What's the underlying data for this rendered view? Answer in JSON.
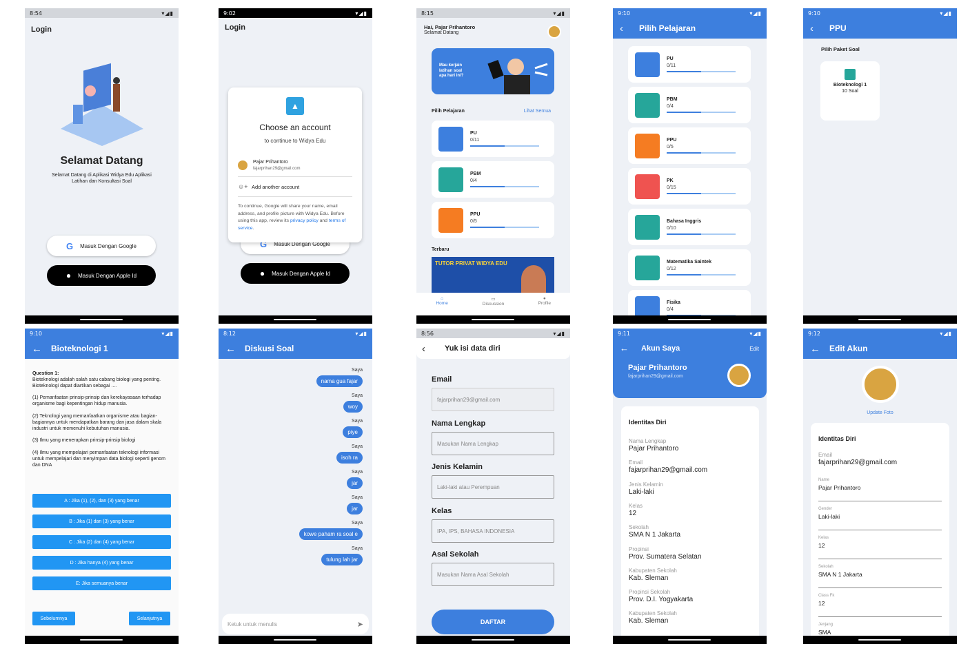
{
  "s1": {
    "time": "8:54",
    "title": "Login",
    "welcome": "Selamat Datang",
    "desc": "Selamat Datang di Aplikasi Widya Edu Aplikasi Latihan dan Konsultasi Soal",
    "google_btn": "Masuk Dengan Google",
    "apple_btn": "Masuk Dengan Apple Id"
  },
  "s2": {
    "time": "9:02",
    "title": "Login",
    "dialog_title": "Choose an account",
    "dialog_sub": "to continue to Widya Edu",
    "acct_name": "Pajar Prihantoro",
    "acct_email": "fajarprihan29@gmail.com",
    "add_account": "Add another account",
    "notice": "To continue, Google will share your name, email address, and profile picture with Widya Edu. Before using this app, review its",
    "privacy": "privacy policy",
    "and": "and",
    "terms": "terms of service",
    "google_btn": "Masuk Dengan Google",
    "apple_btn": "Masuk Dengan Apple Id"
  },
  "s3": {
    "time": "8:15",
    "greeting": "Hai, Pajar Prihantoro",
    "welcome": "Selamat Datang",
    "banner": "Mau kerjain latihan soal apa hari ini?",
    "section": "Pilih Pelajaran",
    "see_all": "Lihat Semua",
    "subjects": [
      {
        "name": "PU",
        "progress": "0/11"
      },
      {
        "name": "PBM",
        "progress": "0/4"
      },
      {
        "name": "PPU",
        "progress": "0/5"
      }
    ],
    "recent": "Terbaru",
    "promo": "TUTOR PRIVAT WIDYA EDU",
    "nav": [
      "Home",
      "Discussion",
      "Profile"
    ]
  },
  "s4": {
    "time": "9:10",
    "title": "Pilih Pelajaran",
    "subjects": [
      {
        "name": "PU",
        "progress": "0/11"
      },
      {
        "name": "PBM",
        "progress": "0/4"
      },
      {
        "name": "PPU",
        "progress": "0/5"
      },
      {
        "name": "PK",
        "progress": "0/15"
      },
      {
        "name": "Bahasa Inggris",
        "progress": "0/10"
      },
      {
        "name": "Matematika Saintek",
        "progress": "0/12"
      },
      {
        "name": "Fisika",
        "progress": "0/4"
      }
    ]
  },
  "s5": {
    "time": "9:10",
    "title": "PPU",
    "section": "Pilih Paket Soal",
    "pkg_name": "Bioteknologi 1",
    "pkg_count": "10 Soal"
  },
  "s6": {
    "time": "9:10",
    "title": "Bioteknologi 1",
    "q_label": "Question 1:",
    "question": "Bioteknologi adalah salah satu cabang biologi yang penting. Bioteknologi dapat diartikan sebagai ....",
    "options": [
      "(1) Pemanfaatan prinsip-prinsip dan kerekayasaan terhadap organisme bagi kepentingan hidup manusia.",
      "(2) Teknologi yang memanfaatkan organisme atau bagian-bagiannya untuk mendapatkan barang dan jasa dalam skala industri untuk memenuhi kebutuhan manusia.",
      "(3) Ilmu yang menerapkan prinsip-prinsip biologi",
      "(4) Ilmu yang mempelajari pemanfaatan teknologi informasi untuk mempelajari dan menyimpan data biologi seperti genom dan DNA"
    ],
    "answers": [
      "A : Jika (1), (2), dan (3) yang benar",
      "B : Jika (1) dan (3) yang benar",
      "C : Jika (2) dan (4) yang benar",
      "D : Jika hanya (4) yang benar",
      "E: Jika semuanya benar"
    ],
    "prev": "Sebelumnya",
    "next": "Selanjutnya"
  },
  "s7": {
    "time": "8:12",
    "title": "Diskusi Soal",
    "sender": "Saya",
    "messages": [
      "nama gua fajar",
      "woy",
      "piye",
      "isoh ra",
      "jar",
      "jar",
      "kowe paham ra soal e",
      "tulung lah jar"
    ],
    "placeholder": "Ketuk untuk menulis"
  },
  "s8": {
    "time": "8:56",
    "title": "Yuk isi data diri",
    "email_label": "Email",
    "email_val": "fajarprihan29@gmail.com",
    "name_label": "Nama Lengkap",
    "name_ph": "Masukan Nama Lengkap",
    "gender_label": "Jenis Kelamin",
    "gender_ph": "Laki-laki atau Perempuan",
    "class_label": "Kelas",
    "class_ph": "IPA, IPS, BAHASA INDONESIA",
    "school_label": "Asal Sekolah",
    "school_ph": "Masukan Nama Asal Sekolah",
    "submit": "DAFTAR"
  },
  "s9": {
    "time": "9:11",
    "title": "Akun Saya",
    "edit": "Edit",
    "name": "Pajar Prihantoro",
    "email": "fajarprihan29@gmail.com",
    "section": "Identitas Diri",
    "fields": [
      {
        "label": "Nama Lengkap",
        "value": "Pajar Prihantoro"
      },
      {
        "label": "Email",
        "value": "fajarprihan29@gmail.com"
      },
      {
        "label": "Jenis Kelamin",
        "value": "Laki-laki"
      },
      {
        "label": "Kelas",
        "value": "12"
      },
      {
        "label": "Sekolah",
        "value": "SMA N 1 Jakarta"
      },
      {
        "label": "Propinsi",
        "value": "Prov. Sumatera Selatan"
      },
      {
        "label": "Kabupaten Sekolah",
        "value": "Kab. Sleman"
      },
      {
        "label": "Propinsi Sekolah",
        "value": "Prov. D.I. Yogyakarta"
      },
      {
        "label": "Kabupaten Sekolah",
        "value": "Kab. Sleman"
      }
    ]
  },
  "s10": {
    "time": "9:12",
    "title": "Edit Akun",
    "update_photo": "Update Foto",
    "section": "Identitas Diri",
    "email_label": "Email",
    "email_val": "fajarprihan29@gmail.com",
    "fields": [
      {
        "label": "Name",
        "value": "Pajar Prihantoro"
      },
      {
        "label": "Gender",
        "value": "Laki-laki"
      },
      {
        "label": "Kelas",
        "value": "12"
      },
      {
        "label": "Sekolah",
        "value": "SMA N 1 Jakarta"
      },
      {
        "label": "Class Fk",
        "value": "12"
      },
      {
        "label": "Jenjang",
        "value": "SMA"
      }
    ]
  },
  "colors": {
    "primary": "#3d7fde",
    "answer": "#2196f3",
    "bg": "#eef1f6"
  }
}
